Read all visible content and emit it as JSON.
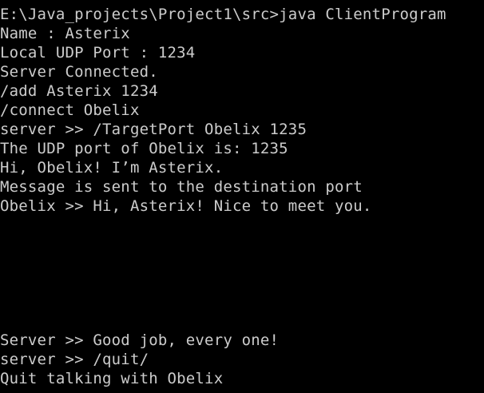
{
  "console": {
    "lines": [
      "E:\\Java_projects\\Project1\\src>java ClientProgram",
      "Name : Asterix",
      "Local UDP Port : 1234",
      "Server Connected.",
      "/add Asterix 1234",
      "/connect Obelix",
      "server >> /TargetPort Obelix 1235",
      "The UDP port of Obelix is: 1235",
      "Hi, Obelix! I’m Asterix.",
      "Message is sent to the destination port",
      "Obelix >> Hi, Asterix! Nice to meet you.",
      "Server >> Good job, every one!",
      "server >> /quit/",
      "Quit talking with Obelix"
    ],
    "colors": {
      "background": "#000000",
      "text": "#cccccc"
    }
  }
}
